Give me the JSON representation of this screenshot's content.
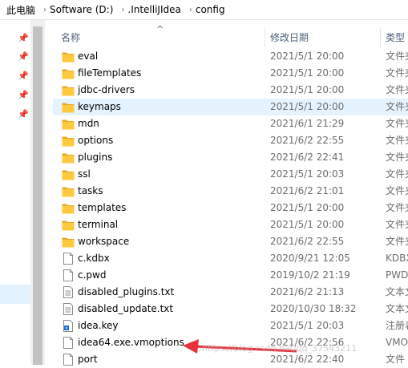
{
  "breadcrumb": {
    "items": [
      "此电脑",
      "Software (D:)",
      ".IntelliJIdea",
      "config"
    ],
    "separator": "›"
  },
  "columns": {
    "name": "名称",
    "date": "修改日期",
    "type": "类型",
    "sort_indicator": "^"
  },
  "files": [
    {
      "name": "eval",
      "date": "2021/5/1 20:00",
      "type": "文件夹",
      "kind": "folder"
    },
    {
      "name": "fileTemplates",
      "date": "2021/5/1 20:00",
      "type": "文件夹",
      "kind": "folder"
    },
    {
      "name": "jdbc-drivers",
      "date": "2021/5/1 20:00",
      "type": "文件夹",
      "kind": "folder"
    },
    {
      "name": "keymaps",
      "date": "2021/5/1 20:00",
      "type": "文件夹",
      "kind": "folder",
      "selected": true
    },
    {
      "name": "mdn",
      "date": "2021/6/1 21:29",
      "type": "文件夹",
      "kind": "folder"
    },
    {
      "name": "options",
      "date": "2021/6/2 22:55",
      "type": "文件夹",
      "kind": "folder"
    },
    {
      "name": "plugins",
      "date": "2021/6/2 22:41",
      "type": "文件夹",
      "kind": "folder"
    },
    {
      "name": "ssl",
      "date": "2021/5/1 20:03",
      "type": "文件夹",
      "kind": "folder"
    },
    {
      "name": "tasks",
      "date": "2021/6/2 21:01",
      "type": "文件夹",
      "kind": "folder"
    },
    {
      "name": "templates",
      "date": "2021/5/1 20:00",
      "type": "文件夹",
      "kind": "folder"
    },
    {
      "name": "terminal",
      "date": "2021/5/1 20:00",
      "type": "文件夹",
      "kind": "folder"
    },
    {
      "name": "workspace",
      "date": "2021/6/2 22:55",
      "type": "文件夹",
      "kind": "folder"
    },
    {
      "name": "c.kdbx",
      "date": "2020/9/21 12:05",
      "type": "KDBX",
      "kind": "file"
    },
    {
      "name": "c.pwd",
      "date": "2019/10/2 21:19",
      "type": "PWD",
      "kind": "file"
    },
    {
      "name": "disabled_plugins.txt",
      "date": "2021/6/2 21:13",
      "type": "文本文",
      "kind": "text"
    },
    {
      "name": "disabled_update.txt",
      "date": "2020/10/30 18:32",
      "type": "文本文",
      "kind": "text"
    },
    {
      "name": "idea.key",
      "date": "2021/5/1 20:03",
      "type": "注册表",
      "kind": "key"
    },
    {
      "name": "idea64.exe.vmoptions",
      "date": "2021/6/2 22:56",
      "type": "VMO",
      "kind": "file"
    },
    {
      "name": "port",
      "date": "2021/6/2 22:40",
      "type": "文件",
      "kind": "file"
    }
  ],
  "annotation": {
    "watermark": "https://blog.csdn.net/qq_37543211",
    "arrow_color": "#e8323c"
  },
  "colors": {
    "folder": "#ffc83d",
    "folder_dark": "#e8a928",
    "selection": "#e5f3ff",
    "header_text": "#4c607a"
  }
}
